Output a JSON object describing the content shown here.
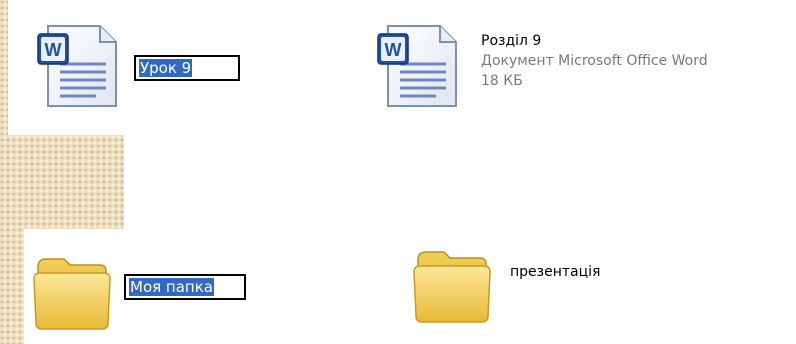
{
  "files": [
    {
      "name": "Урок 9",
      "type": "word-document",
      "editing": true
    },
    {
      "name": "Розділ 9",
      "type": "word-document",
      "editing": false,
      "description": "Документ Microsoft Office Word",
      "size": "18 КБ"
    },
    {
      "name": "Моя папка",
      "type": "folder",
      "editing": true
    },
    {
      "name": "презентація",
      "type": "folder",
      "editing": false
    }
  ],
  "colors": {
    "selection": "#316ac5",
    "folder": "#f5d46a",
    "word_badge": "#1f4fa8"
  },
  "icons": [
    "word-document-icon",
    "folder-icon"
  ]
}
